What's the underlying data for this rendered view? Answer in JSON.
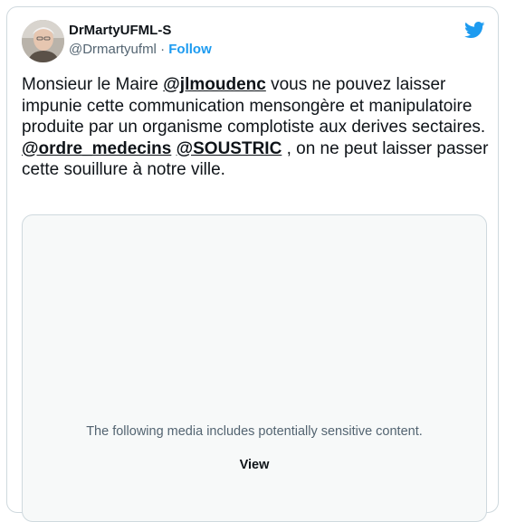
{
  "author": {
    "display_name": "DrMartyUFML-S",
    "handle": "@Drmartyufml",
    "separator": "·",
    "follow_label": "Follow"
  },
  "icons": {
    "brand": "twitter-bird-icon",
    "brand_color": "#1d9bf0"
  },
  "tweet": {
    "p1": "Monsieur le Maire ",
    "m1": "@jlmoudenc",
    "p2": " vous ne pouvez laisser impunie cette communication mensongère et manipulatoire produite par un organisme complotiste aux derives sectaires.\n",
    "m2": "@ordre_medecins",
    "p3": " ",
    "m3": "@SOUSTRIC",
    "p4": " , on ne peut laisser passer cette souillure à notre ville."
  },
  "media": {
    "warning_text": "The following media includes potentially sensitive content.",
    "view_label": "View"
  }
}
